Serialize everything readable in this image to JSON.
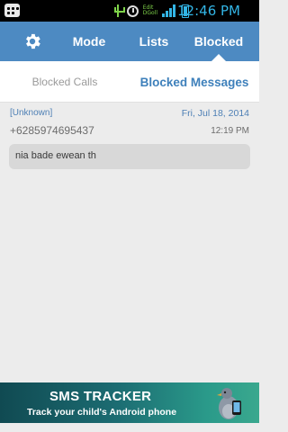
{
  "status_bar": {
    "time": "12:46 PM",
    "data_label_top": "Edit",
    "data_label_bottom": "DGoll"
  },
  "top_nav": {
    "tabs": [
      {
        "label": "Mode"
      },
      {
        "label": "Lists"
      },
      {
        "label": "Blocked"
      }
    ],
    "active_tab": "Blocked"
  },
  "sub_tabs": {
    "calls": "Blocked Calls",
    "messages": "Blocked Messages",
    "active": "Blocked Messages"
  },
  "message": {
    "sender": "[Unknown]",
    "date": "Fri, Jul 18, 2014",
    "number": "+6285974695437",
    "time": "12:19 PM",
    "text": "nia bade ewean th"
  },
  "ad": {
    "title": "SMS TRACKER",
    "subtitle": "Track your child's Android phone"
  },
  "colors": {
    "nav_blue": "#4d8ac2",
    "accent_blue": "#3e80bb",
    "status_cyan": "#33b5e5",
    "ad_teal": "#1c6c72"
  }
}
